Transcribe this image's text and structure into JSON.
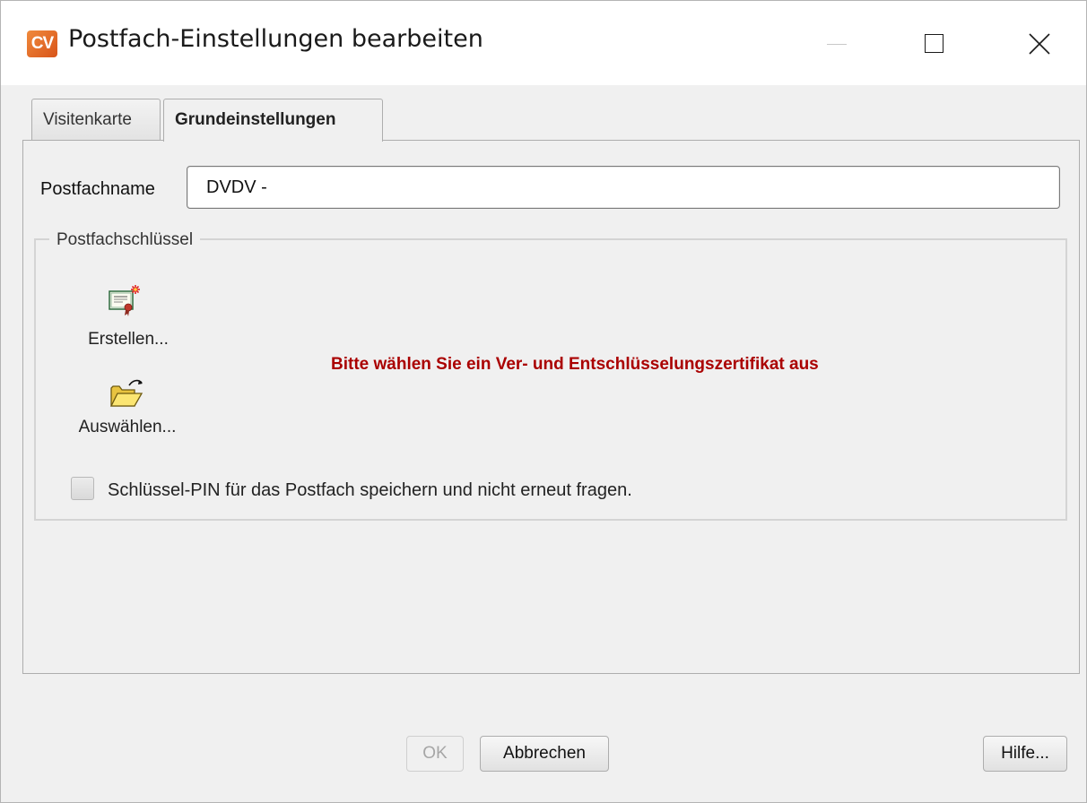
{
  "window": {
    "logo_text": "CV",
    "title": "Postfach-Einstellungen bearbeiten"
  },
  "tabs": [
    {
      "label": "Visitenkarte",
      "active": false
    },
    {
      "label": "Grundeinstellungen",
      "active": true
    }
  ],
  "form": {
    "postfachname_label": "Postfachname",
    "postfachname_value": "DVDV -"
  },
  "schluessel_group": {
    "legend": "Postfachschlüssel",
    "create_label": "Erstellen...",
    "select_label": "Auswählen...",
    "status_message": "Bitte wählen Sie ein Ver- und Entschlüsselungszertifikat aus",
    "status_color": "#aa0000",
    "save_pin_label": "Schlüssel-PIN für das Postfach speichern und nicht erneut fragen.",
    "save_pin_checked": false
  },
  "footer": {
    "ok_label": "OK",
    "ok_enabled": false,
    "cancel_label": "Abbrechen",
    "help_label": "Hilfe..."
  },
  "icons": {
    "logo": "cv-app-logo-icon",
    "minimize": "minimize-icon",
    "maximize": "maximize-icon",
    "close": "close-icon",
    "create": "certificate-new-icon",
    "select": "folder-open-icon"
  },
  "colors": {
    "brand": "#e06a28"
  }
}
